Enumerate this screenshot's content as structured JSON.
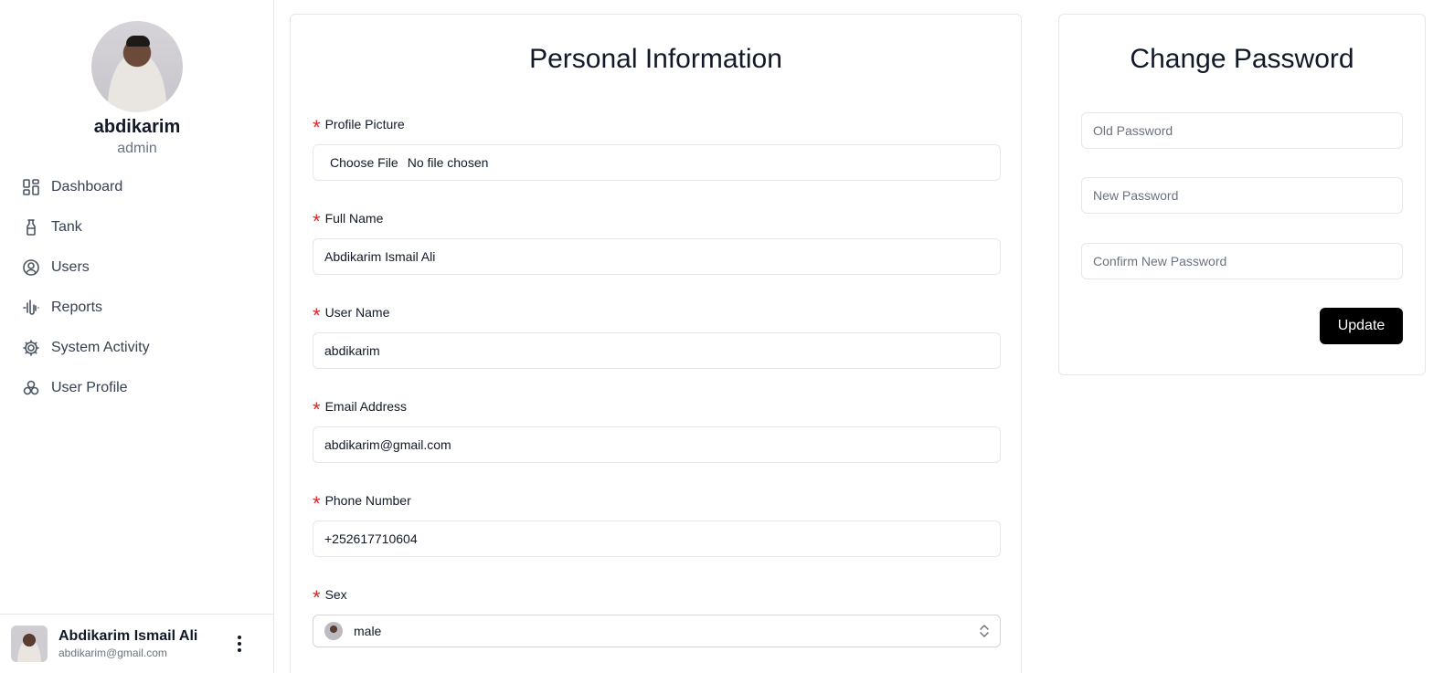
{
  "sidebar": {
    "profile": {
      "name": "abdikarim",
      "role": "admin"
    },
    "items": [
      {
        "label": "Dashboard",
        "icon": "dashboard-icon"
      },
      {
        "label": "Tank",
        "icon": "bottle-icon"
      },
      {
        "label": "Users",
        "icon": "user-circle-icon"
      },
      {
        "label": "Reports",
        "icon": "waveform-icon"
      },
      {
        "label": "System Activity",
        "icon": "gear-icon"
      },
      {
        "label": "User Profile",
        "icon": "circles-icon"
      }
    ],
    "footer": {
      "name": "Abdikarim Ismail Ali",
      "email": "abdikarim@gmail.com"
    }
  },
  "personal": {
    "title": "Personal Information",
    "profile_picture": {
      "label": "Profile Picture",
      "button": "Choose File",
      "status": "No file chosen"
    },
    "full_name": {
      "label": "Full Name",
      "value": "Abdikarim Ismail Ali"
    },
    "user_name": {
      "label": "User Name",
      "value": "abdikarim"
    },
    "email": {
      "label": "Email Address",
      "value": "abdikarim@gmail.com"
    },
    "phone": {
      "label": "Phone Number",
      "value": "+252617710604"
    },
    "sex": {
      "label": "Sex",
      "value": "male"
    },
    "required_mark": "*"
  },
  "password": {
    "title": "Change Password",
    "old_placeholder": "Old Password",
    "new_placeholder": "New Password",
    "confirm_placeholder": "Confirm New Password",
    "update_label": "Update"
  },
  "colors": {
    "accent": "#000000",
    "required": "#dc2626",
    "border": "#e5e7eb"
  }
}
